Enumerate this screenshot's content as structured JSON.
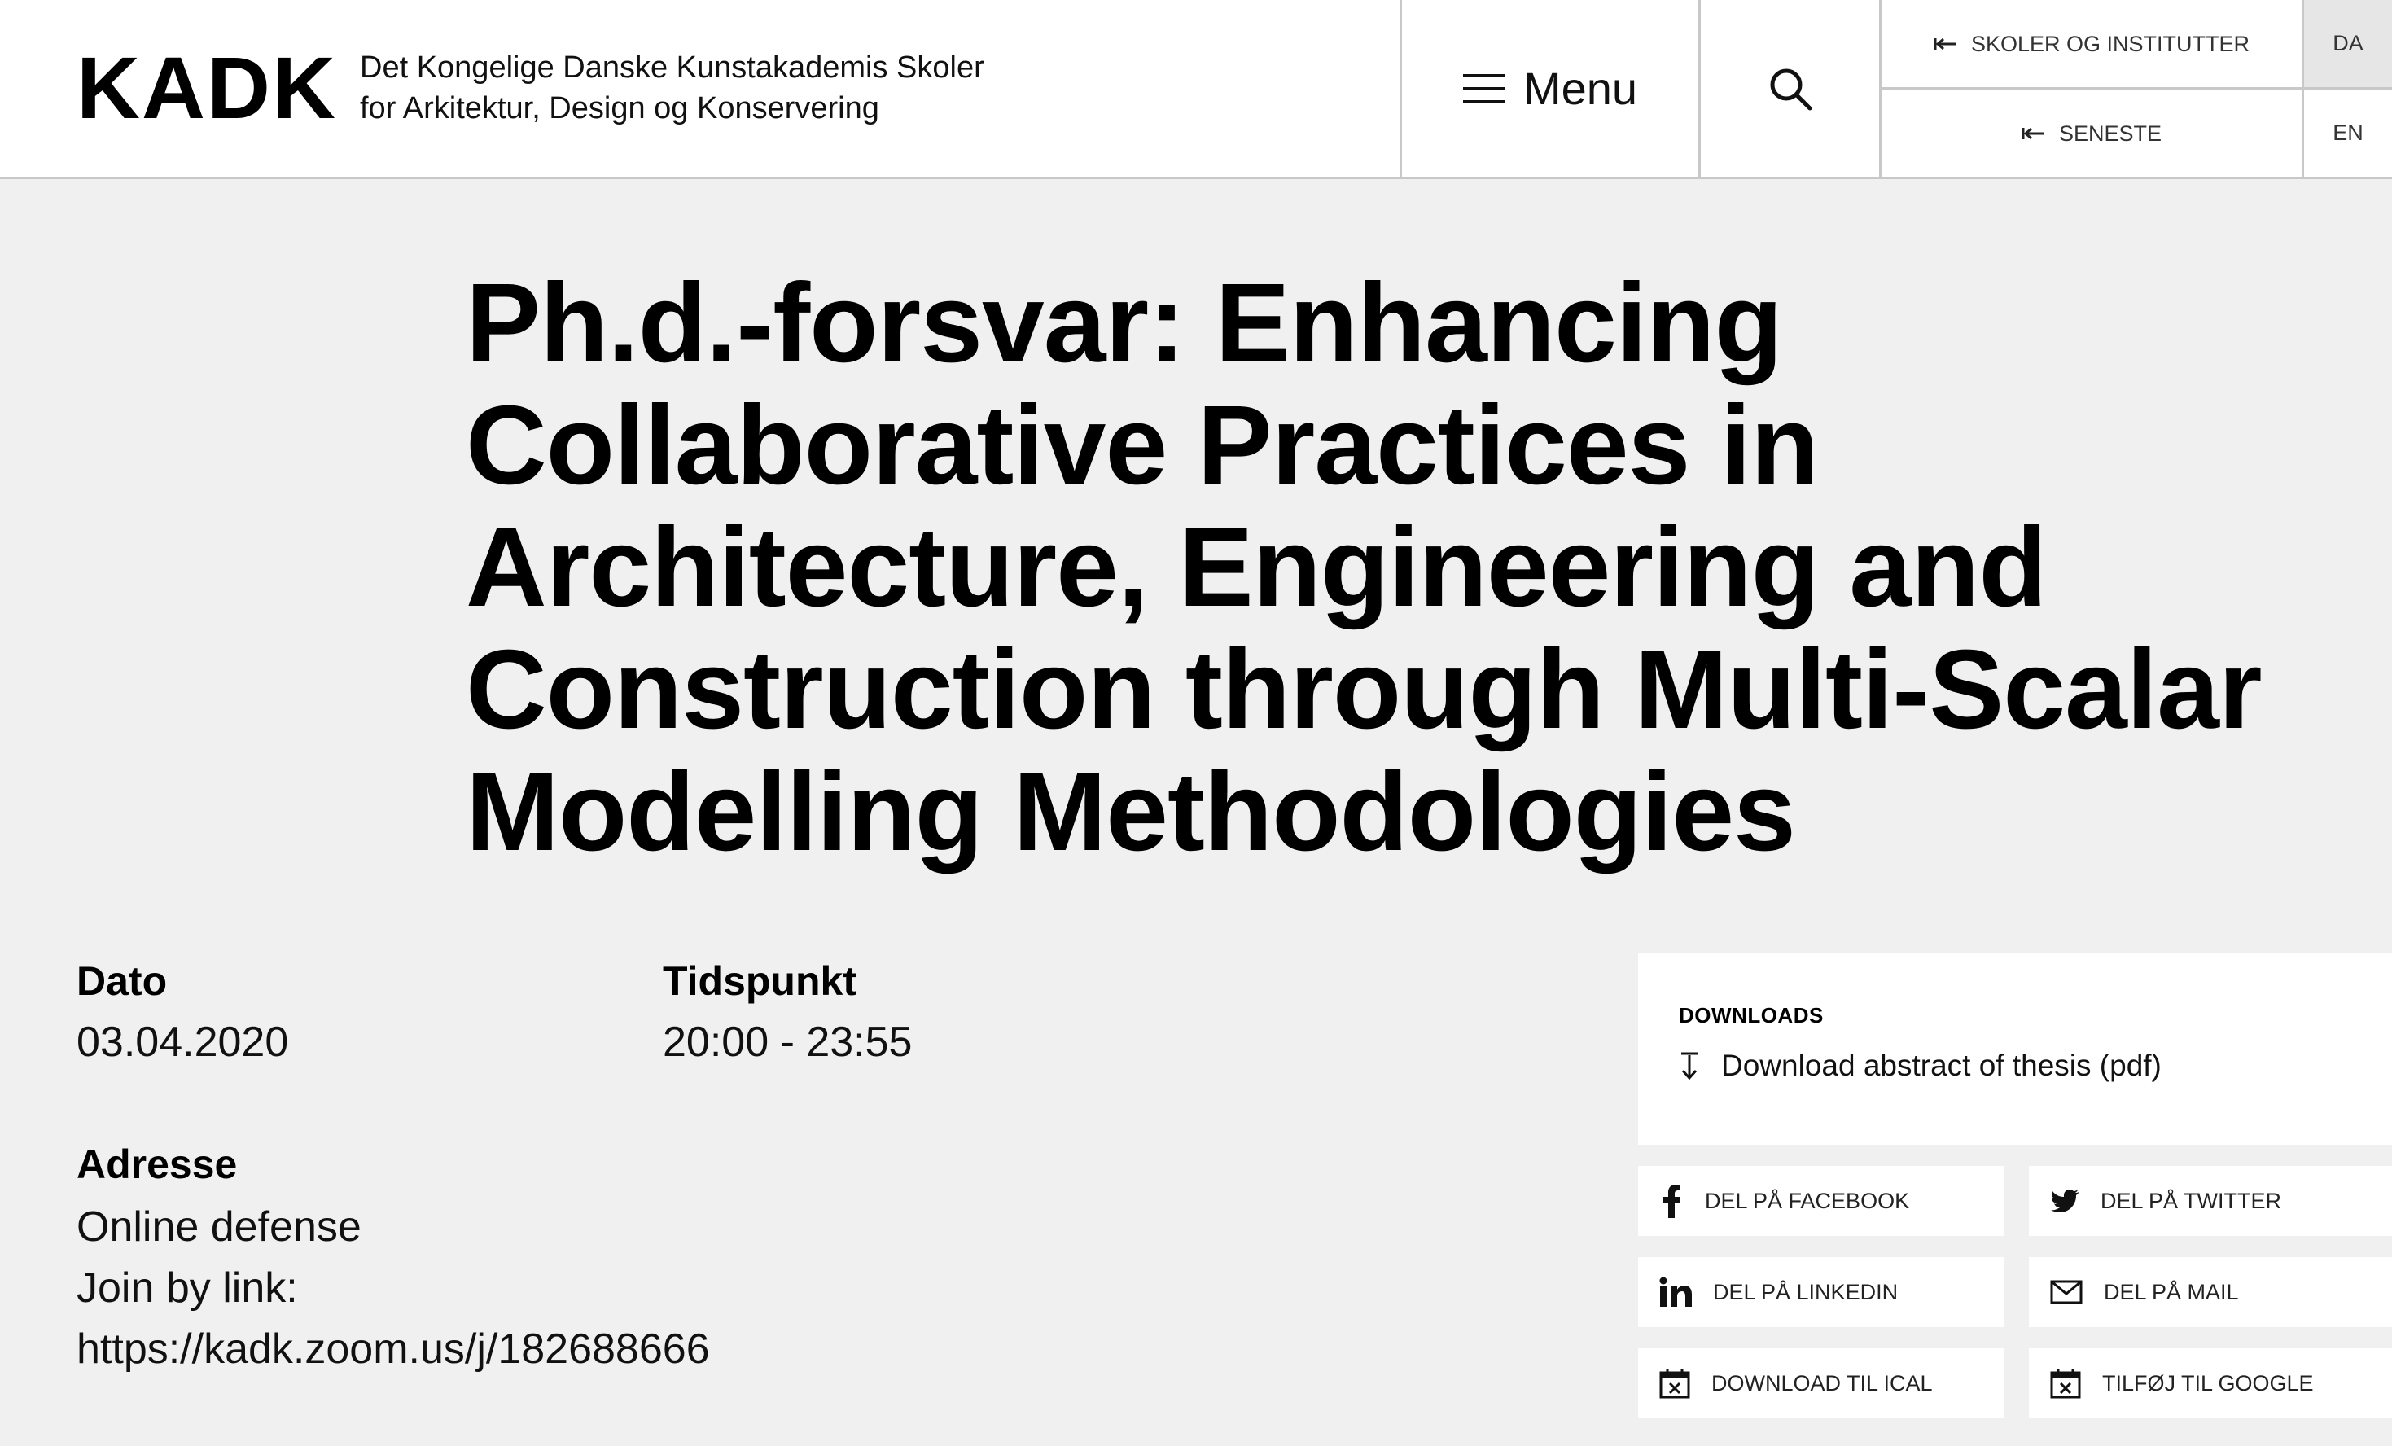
{
  "header": {
    "logo": "KADK",
    "subtitle_line1": "Det Kongelige Danske Kunstakademis Skoler",
    "subtitle_line2": "for Arkitektur, Design og Konservering",
    "menu_label": "Menu",
    "links": [
      "SKOLER OG INSTITUTTER",
      "SENESTE"
    ],
    "languages": [
      "DA",
      "EN"
    ],
    "active_language": "DA"
  },
  "event": {
    "title": "Ph.d.-forsvar: Enhancing Collaborative Practices in Architecture, Engineering and Construction through Multi-Scalar Modelling Methodologies",
    "date_label": "Dato",
    "date_value": "03.04.2020",
    "time_label": "Tidspunkt",
    "time_value": "20:00 - 23:55",
    "address_label": "Adresse",
    "address_lines": [
      "Online defense",
      "Join by link:",
      "https://kadk.zoom.us/j/182688666"
    ]
  },
  "downloads": {
    "heading": "DOWNLOADS",
    "link": "Download abstract of thesis (pdf)"
  },
  "share": {
    "facebook": "DEL PÅ FACEBOOK",
    "twitter": "DEL PÅ TWITTER",
    "linkedin": "DEL PÅ LINKEDIN",
    "mail": "DEL PÅ MAIL",
    "ical": "DOWNLOAD TIL ICAL",
    "google": "TILFØJ TIL GOOGLE"
  },
  "icons": {
    "menu": "hamburger-icon",
    "search": "search-icon",
    "back_arrow": "arrow-left-bar-icon",
    "download": "download-arrow-icon",
    "facebook": "facebook-icon",
    "twitter": "twitter-icon",
    "linkedin": "linkedin-icon",
    "mail": "mail-icon",
    "calendar": "calendar-icon"
  }
}
